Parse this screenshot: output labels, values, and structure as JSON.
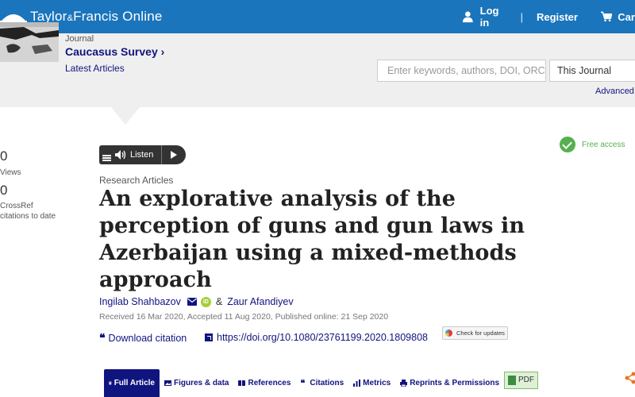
{
  "header": {
    "brand": "Taylor",
    "brand_amp": "&",
    "brand_rest": "Francis Online",
    "login": "Log in",
    "divider": "|",
    "register": "Register",
    "cart": "Cart"
  },
  "journal": {
    "label": "Journal",
    "title": "Caucasus Survey",
    "chevron": "›",
    "latest": "Latest Articles"
  },
  "search": {
    "placeholder": "Enter keywords, authors, DOI, ORC",
    "scope": "This Journal",
    "advanced": "Advanced se"
  },
  "metrics": [
    {
      "value": "0",
      "label": "Views"
    },
    {
      "value": "0",
      "label": "CrossRef citations to date"
    }
  ],
  "listen": {
    "label": "Listen"
  },
  "access": {
    "label": "Free access"
  },
  "article": {
    "section": "Research Articles",
    "title": "An explorative analysis of the perception of guns and gun laws in Azerbaijan using a mixed-methods approach",
    "author1": "Ingilab Shahbazov",
    "orcid": "iD",
    "amp": "&",
    "author2": "Zaur Afandiyev",
    "dates": "Received 16 Mar 2020, Accepted 11 Aug 2020, Published online: 21 Sep 2020",
    "download": "Download citation",
    "doi": "https://doi.org/10.1080/23761199.2020.1809808",
    "check_updates": "Check for updates"
  },
  "tabs": [
    "Full Article",
    "Figures & data",
    "References",
    "Citations",
    "Metrics",
    "Reprints & Permissions",
    "PDF"
  ],
  "colors": {
    "brand_blue": "#1a75bc",
    "link_navy": "#10147e",
    "access_green": "#56b04f"
  }
}
